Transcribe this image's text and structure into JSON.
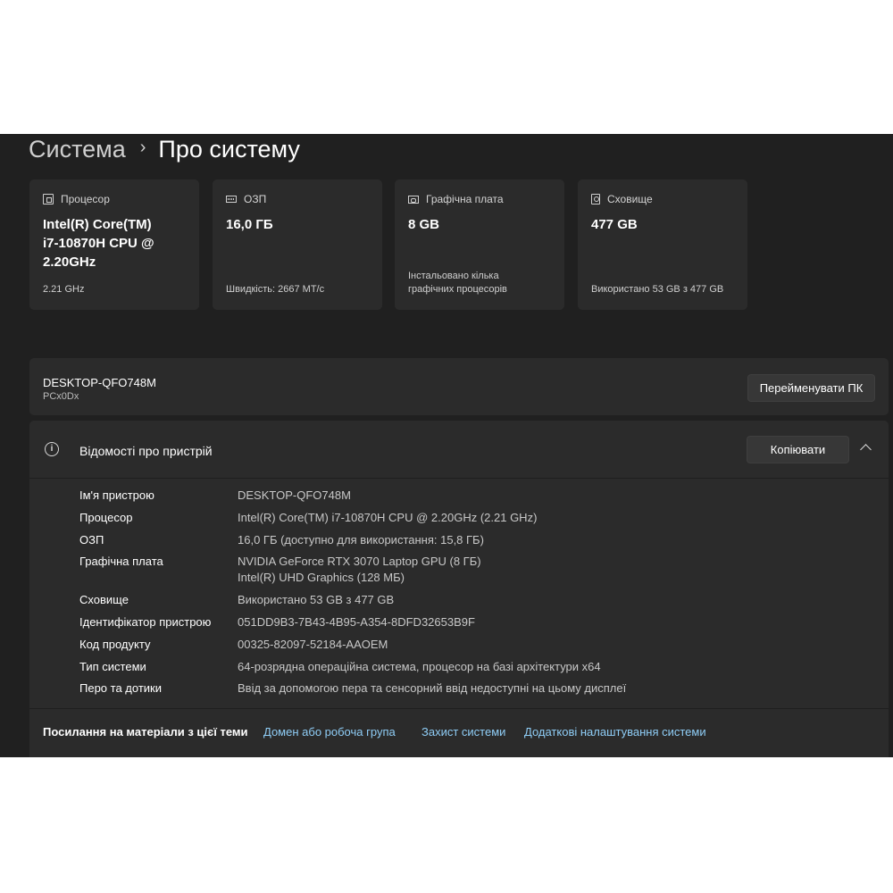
{
  "breadcrumb": {
    "parent": "Система",
    "separator": "›",
    "current": "Про систему"
  },
  "cards": [
    {
      "icon": "processor-icon",
      "label": "Процесор",
      "value_lines": [
        "Intel(R) Core(TM)",
        "i7-10870H CPU @",
        "2.20GHz"
      ],
      "sub_lines": [
        "2.21 GHz"
      ]
    },
    {
      "icon": "ram-icon",
      "label": "ОЗП",
      "value_lines": [
        "16,0 ГБ"
      ],
      "sub_lines": [
        "Швидкість: 2667 МТ/с"
      ]
    },
    {
      "icon": "graphics-card-icon",
      "label": "Графічна плата",
      "value_lines": [
        "8 GB"
      ],
      "sub_lines": [
        "Інстальовано кілька",
        "графічних процесорів"
      ]
    },
    {
      "icon": "storage-icon",
      "label": "Сховище",
      "value_lines": [
        "477 GB"
      ],
      "sub_lines": [
        "Використано 53 GB з 477 GB"
      ]
    }
  ],
  "device": {
    "name": "DESKTOP-QFO748M",
    "model": "PCx0Dx",
    "rename_label": "Перейменувати ПК"
  },
  "specs": {
    "title": "Відомості про пристрій",
    "copy_label": "Копіювати",
    "rows": [
      {
        "key": "Ім'я пристрою",
        "values": [
          "DESKTOP-QFO748M"
        ]
      },
      {
        "key": "Процесор",
        "values": [
          "Intel(R) Core(TM) i7-10870H CPU @ 2.20GHz (2.21 GHz)"
        ]
      },
      {
        "key": "ОЗП",
        "values": [
          "16,0 ГБ (доступно для використання: 15,8 ГБ)"
        ]
      },
      {
        "key": "Графічна плата",
        "values": [
          "NVIDIA GeForce RTX 3070 Laptop GPU (8 ГБ)",
          "Intel(R) UHD Graphics (128 МБ)"
        ]
      },
      {
        "key": "Сховище",
        "values": [
          "Використано 53 GB з 477 GB"
        ]
      },
      {
        "key": "Ідентифікатор пристрою",
        "values": [
          "051DD9B3-7B43-4B95-A354-8DFD32653B9F"
        ]
      },
      {
        "key": "Код продукту",
        "values": [
          "00325-82097-52184-AAOEM"
        ]
      },
      {
        "key": "Тип системи",
        "values": [
          "64-розрядна операційна система, процесор на базі архітектури x64"
        ]
      },
      {
        "key": "Перо та дотики",
        "values": [
          "Ввід за допомогою пера та сенсорний ввід недоступні на цьому дисплеї"
        ]
      }
    ]
  },
  "related": {
    "label": "Посилання на матеріали з цієї теми",
    "links": [
      "Домен або робоча група",
      "Захист системи",
      "Додаткові налаштування системи"
    ]
  },
  "colors": {
    "background": "#202020",
    "card": "#2b2b2b",
    "link": "#8fcdf6"
  }
}
